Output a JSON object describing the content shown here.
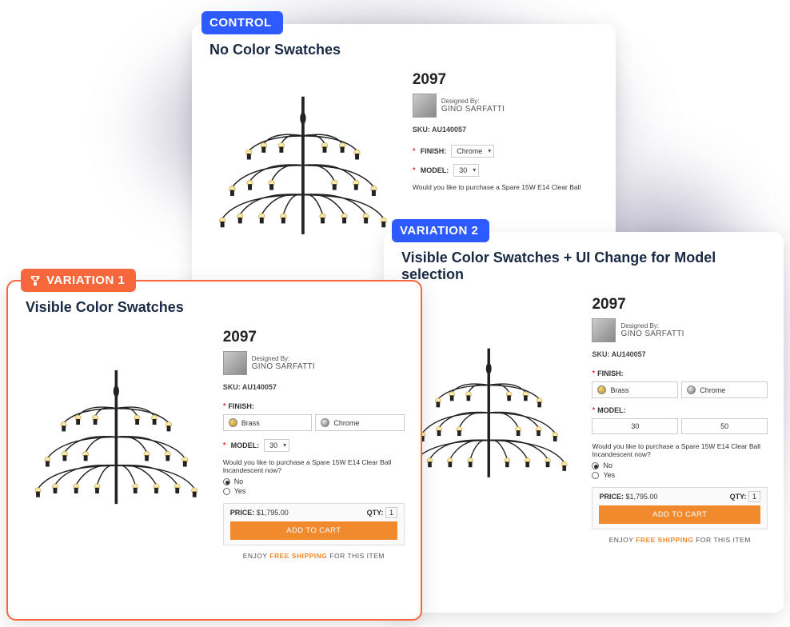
{
  "control": {
    "tag": "CONTROL",
    "title": "No Color Swatches",
    "product_title": "2097",
    "designer_label": "Designed By:",
    "designer_name": "GINO SARFATTI",
    "sku_label": "SKU:",
    "sku_value": "AU140057",
    "finish_label": "FINISH:",
    "finish_value": "Chrome",
    "model_label": "MODEL:",
    "model_value": "30",
    "spare_text": "Would you like to purchase a Spare 15W E14 Clear Ball"
  },
  "v1": {
    "tag": "VARIATION 1",
    "title": "Visible Color Swatches",
    "product_title": "2097",
    "designer_label": "Designed By:",
    "designer_name": "GINO SARFATTI",
    "sku_label": "SKU:",
    "sku_value": "AU140057",
    "finish_label": "FINISH:",
    "swatch_brass": "Brass",
    "swatch_chrome": "Chrome",
    "model_label": "MODEL:",
    "model_value": "30",
    "spare_text": "Would you like to purchase a Spare 15W E14 Clear Ball Incandescent now?",
    "radio_no": "No",
    "radio_yes": "Yes",
    "price_label": "PRICE:",
    "price_value": "$1,795.00",
    "qty_label": "QTY:",
    "qty_value": "1",
    "add_to_cart": "ADD TO CART",
    "ship_prefix": "ENJOY",
    "ship_mid": "FREE SHIPPING",
    "ship_suffix": "FOR THIS ITEM"
  },
  "v2": {
    "tag": "VARIATION 2",
    "title": "Visible Color Swatches + UI Change for Model selection",
    "product_title": "2097",
    "designer_label": "Designed By:",
    "designer_name": "GINO SARFATTI",
    "sku_label": "SKU:",
    "sku_value": "AU140057",
    "finish_label": "FINISH:",
    "swatch_brass": "Brass",
    "swatch_chrome": "Chrome",
    "model_label": "MODEL:",
    "model_30": "30",
    "model_50": "50",
    "spare_text": "Would you like to purchase a Spare 15W E14 Clear Ball Incandescent now?",
    "radio_no": "No",
    "radio_yes": "Yes",
    "price_label": "PRICE:",
    "price_value": "$1,795.00",
    "qty_label": "QTY:",
    "qty_value": "1",
    "add_to_cart": "ADD TO CART",
    "ship_prefix": "ENJOY",
    "ship_mid": "FREE SHIPPING",
    "ship_suffix": "FOR THIS ITEM"
  }
}
